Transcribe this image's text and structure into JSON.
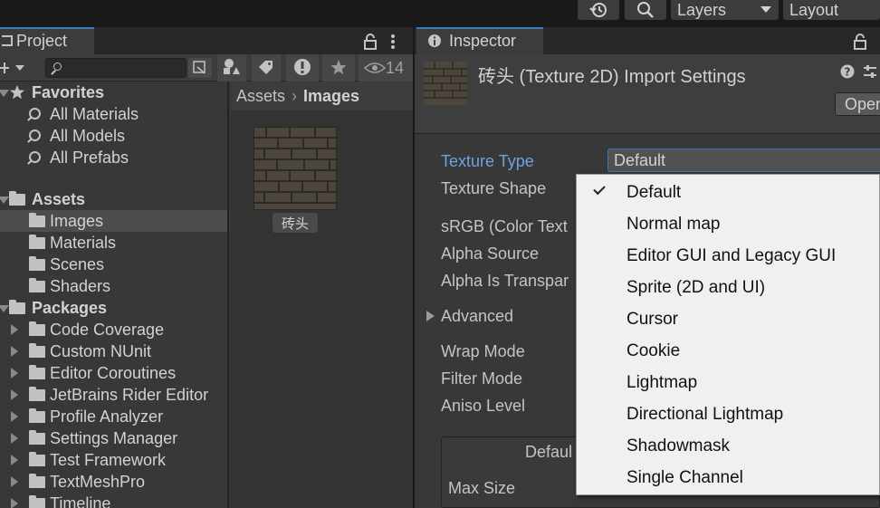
{
  "toolbar": {
    "history_icon": "history-icon",
    "search_icon": "search-icon",
    "layers_label": "Layers",
    "layout_label": "Layout"
  },
  "project": {
    "tab_label": "Project",
    "hidden_count": "14",
    "favorites": {
      "label": "Favorites",
      "items": [
        "All Materials",
        "All Models",
        "All Prefabs"
      ]
    },
    "assets": {
      "label": "Assets",
      "items": [
        "Images",
        "Materials",
        "Scenes",
        "Shaders"
      ]
    },
    "packages": {
      "label": "Packages",
      "items": [
        "Code Coverage",
        "Custom NUnit",
        "Editor Coroutines",
        "JetBrains Rider Editor",
        "Profile Analyzer",
        "Settings Manager",
        "Test Framework",
        "TextMeshPro",
        "Timeline"
      ]
    },
    "breadcrumb": {
      "root": "Assets",
      "current": "Images"
    },
    "asset_item": {
      "name": "砖头"
    }
  },
  "inspector": {
    "tab_label": "Inspector",
    "title": "砖头 (Texture 2D) Import Settings",
    "open_label": "Open",
    "texture_type_label": "Texture Type",
    "texture_type_value": "Default",
    "props": {
      "texture_shape": "Texture Shape",
      "srgb": "sRGB (Color Text",
      "alpha_source": "Alpha Source",
      "alpha_transparency": "Alpha Is Transpar",
      "advanced": "Advanced",
      "wrap_mode": "Wrap Mode",
      "filter_mode": "Filter Mode",
      "aniso_level": "Aniso Level",
      "platform_default": "Defaul",
      "max_size": "Max Size"
    }
  },
  "texture_type_menu": {
    "selected": "Default",
    "options": [
      "Default",
      "Normal map",
      "Editor GUI and Legacy GUI",
      "Sprite (2D and UI)",
      "Cursor",
      "Cookie",
      "Lightmap",
      "Directional Lightmap",
      "Shadowmask",
      "Single Channel"
    ]
  },
  "colors": {
    "accent": "#3a79bb",
    "panel": "#383838",
    "menu_bg": "#f0f0f0"
  }
}
